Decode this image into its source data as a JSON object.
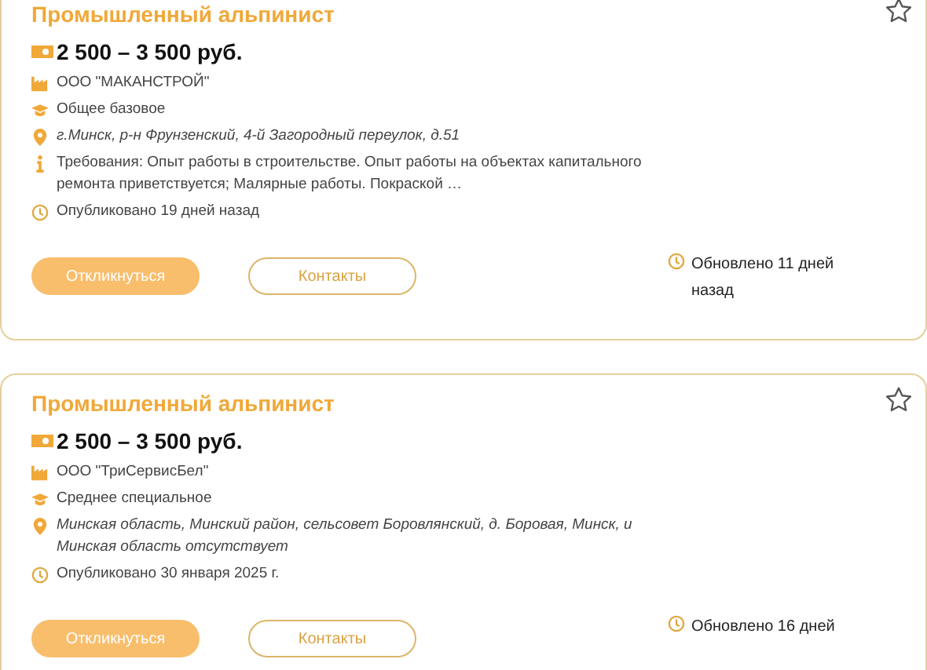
{
  "vacancies": [
    {
      "title": "Промышленный альпинист",
      "favorite": false,
      "salary": "2 500 – 3 500 руб.",
      "company": "ООО \"МАКАНСТРОЙ\"",
      "education": "Общее базовое",
      "address": "г.Минск, р-н Фрунзенский, 4-й Загородный переулок, д.51",
      "requirements": "Требования: Опыт работы в строительстве. Опыт работы на объектах капитального ремонта приветствуется; Малярные работы. Покраской …",
      "published": "Опубликовано 19 дней назад",
      "buttons": [
        "Откликнуться",
        "Контакты"
      ],
      "updated": "Обновлено 11 дней назад"
    },
    {
      "title": "Промышленный альпинист",
      "favorite": false,
      "salary": "2 500 – 3 500 руб.",
      "company": "ООО \"ТриСервисБел\"",
      "education": "Среднее специальное",
      "address": "Минская область, Минский район, сельсовет Боровлянский, д. Боровая, Минск, и Минская область отсутствует",
      "published": "Опубликовано 30 января 2025 г.",
      "buttons": [
        "Откликнуться",
        "Контакты"
      ],
      "updated": "Обновлено 16 дней"
    }
  ]
}
